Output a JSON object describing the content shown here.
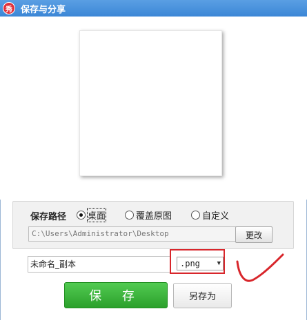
{
  "window": {
    "title": "保存与分享",
    "app_icon_glyph": "秀"
  },
  "save_path": {
    "label": "保存路径",
    "options": [
      {
        "label": "桌面",
        "selected": true
      },
      {
        "label": "覆盖原图",
        "selected": false
      },
      {
        "label": "自定义",
        "selected": false
      }
    ],
    "path_value": "C:\\Users\\Administrator\\Desktop",
    "change_button": "更改"
  },
  "file": {
    "name": "未命名_副本",
    "format": ".png"
  },
  "actions": {
    "save": "保 存",
    "save_as": "另存为"
  },
  "colors": {
    "title_bar": "#3b86d6",
    "save_button": "#2ba02b",
    "annotation_red": "#d8262b"
  }
}
